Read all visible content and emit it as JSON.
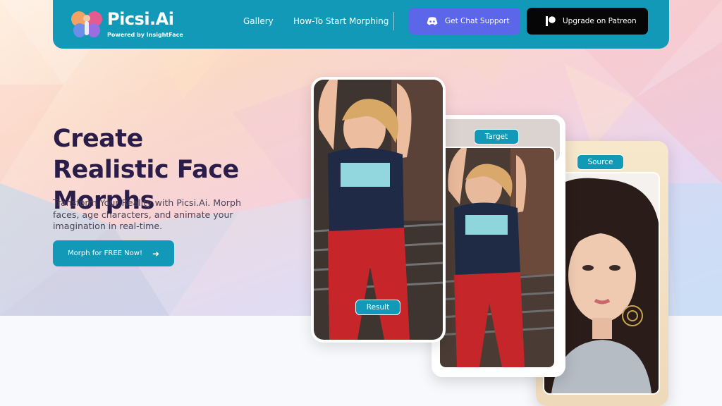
{
  "header": {
    "brand": "Picsi.Ai",
    "powered_by": "Powered by InsightFace",
    "nav": {
      "gallery": "Gallery",
      "how_to": "How-To Start Morphing"
    },
    "support_button": {
      "label": "Get Chat Support",
      "icon": "discord-icon"
    },
    "patreon_button": {
      "label": "Upgrade on Patreon",
      "icon": "patreon-icon"
    }
  },
  "hero": {
    "title": "Create Realistic Face Morphs",
    "subtitle": "Transform Your Reality with Picsi.Ai. Morph faces, age characters, and animate your imagination in real-time.",
    "cta": {
      "label": "Morph for FREE Now!",
      "icon": "arrow-right-icon"
    }
  },
  "cards": {
    "result_label": "Result",
    "target_label": "Target",
    "source_label": "Source"
  },
  "colors": {
    "accent": "#1199b7",
    "discord": "#5b66e8",
    "patreon": "#060606",
    "title": "#2b1d4a"
  }
}
